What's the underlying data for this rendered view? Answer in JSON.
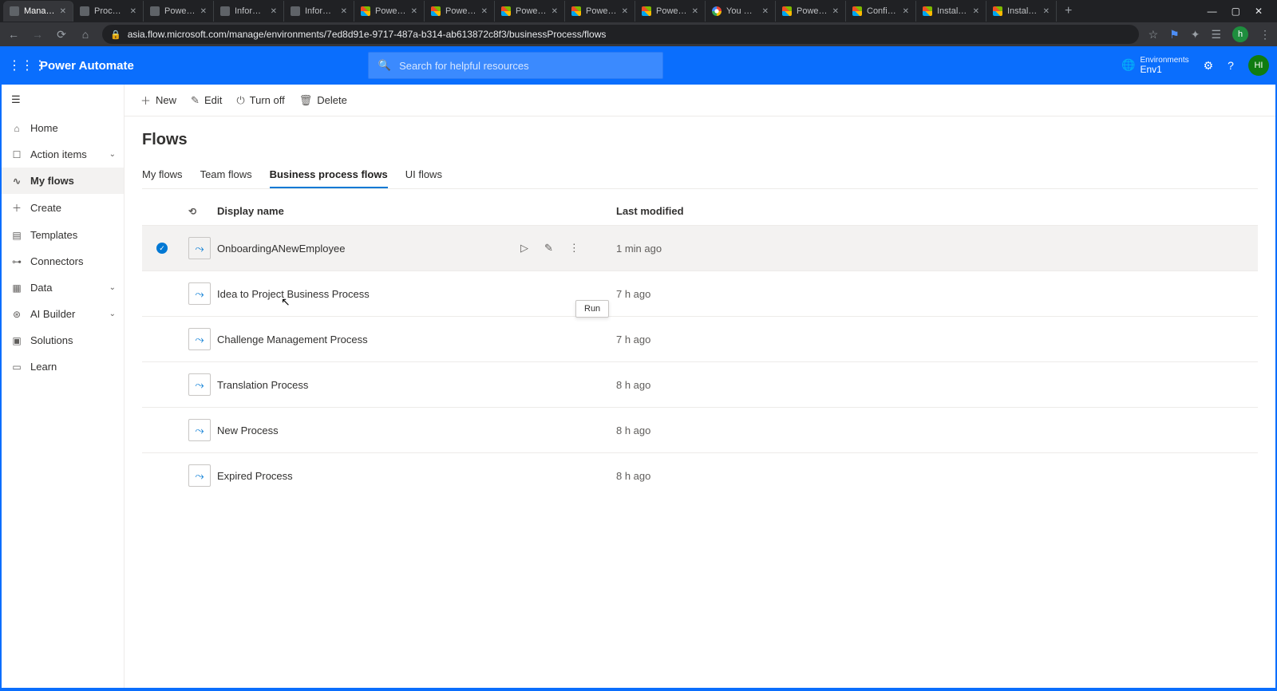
{
  "browser": {
    "tabs": [
      {
        "title": "Manage",
        "favType": "flow"
      },
      {
        "title": "Process",
        "favType": "pa"
      },
      {
        "title": "Power A",
        "favType": "pa"
      },
      {
        "title": "Informat",
        "favType": "pa"
      },
      {
        "title": "Informat",
        "favType": "pa"
      },
      {
        "title": "Power Pl",
        "favType": "ms"
      },
      {
        "title": "Power Pl",
        "favType": "ms"
      },
      {
        "title": "Power Pl",
        "favType": "ms"
      },
      {
        "title": "Power Pl",
        "favType": "ms"
      },
      {
        "title": "Power Pl",
        "favType": "ms"
      },
      {
        "title": "You do n",
        "favType": "g"
      },
      {
        "title": "Power Pl",
        "favType": "ms"
      },
      {
        "title": "Configur",
        "favType": "ms"
      },
      {
        "title": "Install an",
        "favType": "ms"
      },
      {
        "title": "Install an",
        "favType": "ms"
      }
    ],
    "url": "asia.flow.microsoft.com/manage/environments/7ed8d91e-9717-487a-b314-ab613872c8f3/businessProcess/flows",
    "avatar": "h"
  },
  "header": {
    "appName": "Power Automate",
    "searchPlaceholder": "Search for helpful resources",
    "envLabel": "Environments",
    "envName": "Env1",
    "avatar": "HI"
  },
  "sidebar": {
    "items": [
      {
        "icon": "home-icon",
        "label": "Home"
      },
      {
        "icon": "action-icon",
        "label": "Action items",
        "expandable": true
      },
      {
        "icon": "flow-icon",
        "label": "My flows",
        "active": true
      },
      {
        "icon": "plus-icon",
        "label": "Create"
      },
      {
        "icon": "template-icon",
        "label": "Templates"
      },
      {
        "icon": "connector-icon",
        "label": "Connectors"
      },
      {
        "icon": "data-icon",
        "label": "Data",
        "expandable": true
      },
      {
        "icon": "ai-icon",
        "label": "AI Builder",
        "expandable": true
      },
      {
        "icon": "solutions-icon",
        "label": "Solutions"
      },
      {
        "icon": "learn-icon",
        "label": "Learn"
      }
    ]
  },
  "commandBar": {
    "new": "New",
    "edit": "Edit",
    "turnOff": "Turn off",
    "delete": "Delete"
  },
  "page": {
    "title": "Flows",
    "tabs": [
      "My flows",
      "Team flows",
      "Business process flows",
      "UI flows"
    ],
    "activeTab": 2,
    "tooltip": "Run",
    "columns": {
      "name": "Display name",
      "modified": "Last modified"
    },
    "rows": [
      {
        "name": "OnboardingANewEmployee",
        "modified": "1 min ago",
        "selected": true
      },
      {
        "name": "Idea to Project Business Process",
        "modified": "7 h ago"
      },
      {
        "name": "Challenge Management Process",
        "modified": "7 h ago"
      },
      {
        "name": "Translation Process",
        "modified": "8 h ago"
      },
      {
        "name": "New Process",
        "modified": "8 h ago"
      },
      {
        "name": "Expired Process",
        "modified": "8 h ago"
      }
    ]
  }
}
